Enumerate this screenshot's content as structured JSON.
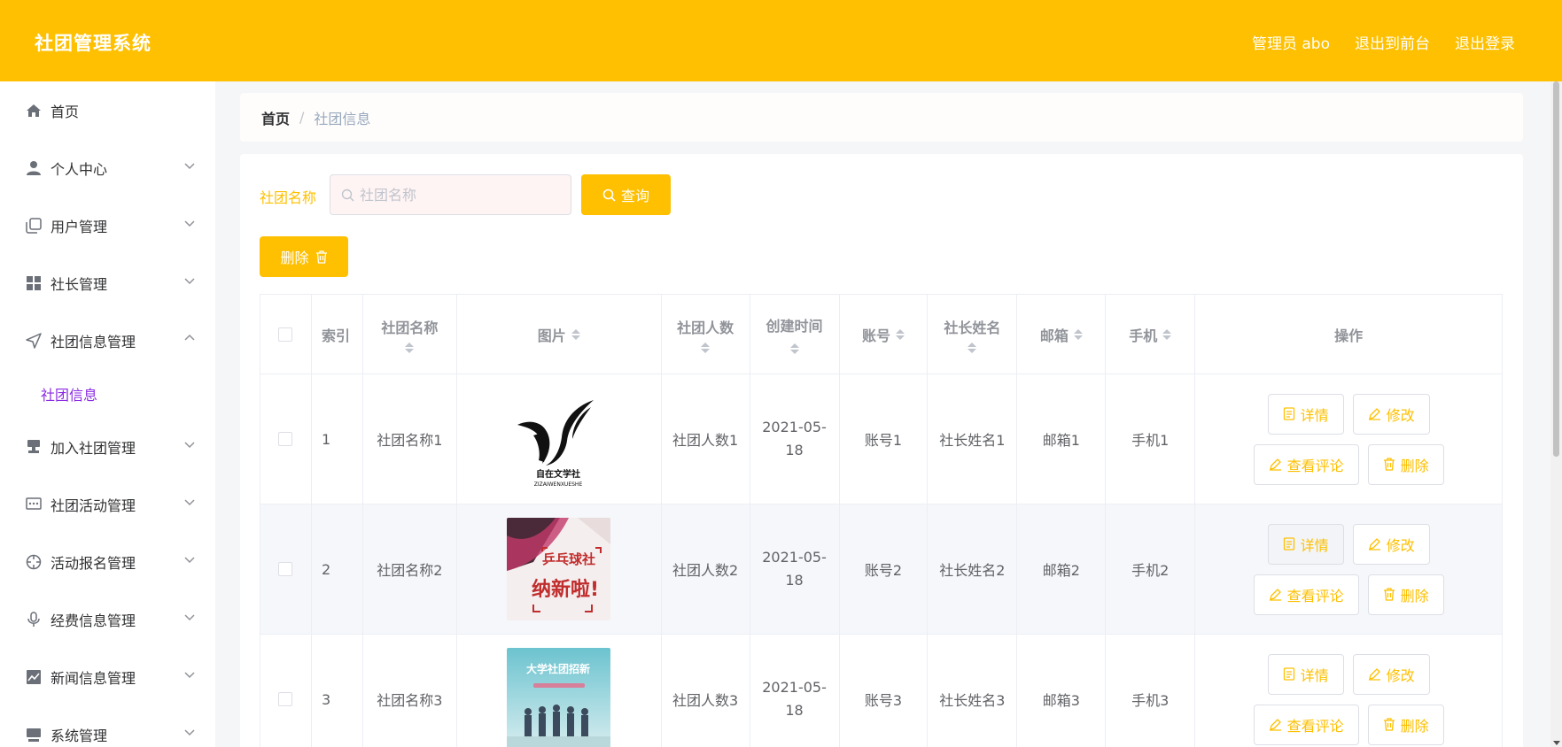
{
  "header": {
    "title": "社团管理系统",
    "links": [
      "管理员 abo",
      "退出到前台",
      "退出登录"
    ]
  },
  "sidebar": {
    "items": [
      {
        "label": "首页",
        "icon": "home-icon",
        "chevron": ""
      },
      {
        "label": "个人中心",
        "icon": "user-icon",
        "chevron": "down"
      },
      {
        "label": "用户管理",
        "icon": "copy-icon",
        "chevron": "down"
      },
      {
        "label": "社长管理",
        "icon": "grid-icon",
        "chevron": "down"
      },
      {
        "label": "社团信息管理",
        "icon": "send-icon",
        "chevron": "up"
      },
      {
        "label": "加入社团管理",
        "icon": "stamp-icon",
        "chevron": "down"
      },
      {
        "label": "社团活动管理",
        "icon": "chat-dots-icon",
        "chevron": "down"
      },
      {
        "label": "活动报名管理",
        "icon": "crosshair-icon",
        "chevron": "down"
      },
      {
        "label": "经费信息管理",
        "icon": "microphone-icon",
        "chevron": "down"
      },
      {
        "label": "新闻信息管理",
        "icon": "chart-line-icon",
        "chevron": "down"
      },
      {
        "label": "系统管理",
        "icon": "monitor-icon",
        "chevron": "down"
      }
    ],
    "submenu_active": "社团信息"
  },
  "breadcrumb": {
    "home": "首页",
    "separator": "/",
    "current": "社团信息"
  },
  "search": {
    "label": "社团名称",
    "placeholder": "社团名称",
    "button": "查询"
  },
  "toolbar": {
    "delete_label": "删除"
  },
  "table": {
    "headers": [
      "",
      "索引",
      "社团名称",
      "图片",
      "社团人数",
      "创建时间",
      "账号",
      "社长姓名",
      "邮箱",
      "手机",
      "操作"
    ],
    "rows": [
      {
        "index": "1",
        "name": "社团名称1",
        "members": "社团人数1",
        "created": "2021-05-18",
        "account": "账号1",
        "leader": "社长姓名1",
        "email": "邮箱1",
        "phone": "手机1",
        "image": "zizai-wenxueshe-logo",
        "image_caption_cn": "自在文学社",
        "image_caption_en": "ZIZAIWENXUESHE"
      },
      {
        "index": "2",
        "name": "社团名称2",
        "members": "社团人数2",
        "created": "2021-05-18",
        "account": "账号2",
        "leader": "社长姓名2",
        "email": "邮箱2",
        "phone": "手机2",
        "image": "pingpong-club-poster",
        "image_text_1": "乒乓球社",
        "image_text_2": "纳新啦!"
      },
      {
        "index": "3",
        "name": "社团名称3",
        "members": "社团人数3",
        "created": "2021-05-18",
        "account": "账号3",
        "leader": "社长姓名3",
        "email": "邮箱3",
        "phone": "手机3",
        "image": "university-club-recruit-poster",
        "image_text_1": "大学社团招新"
      }
    ],
    "actions": {
      "detail": "详情",
      "edit": "修改",
      "comments": "查看评论",
      "delete": "删除"
    }
  },
  "colors": {
    "primary": "#fec001",
    "active_submenu": "#8a2be2",
    "background": "#f5f6f8"
  }
}
